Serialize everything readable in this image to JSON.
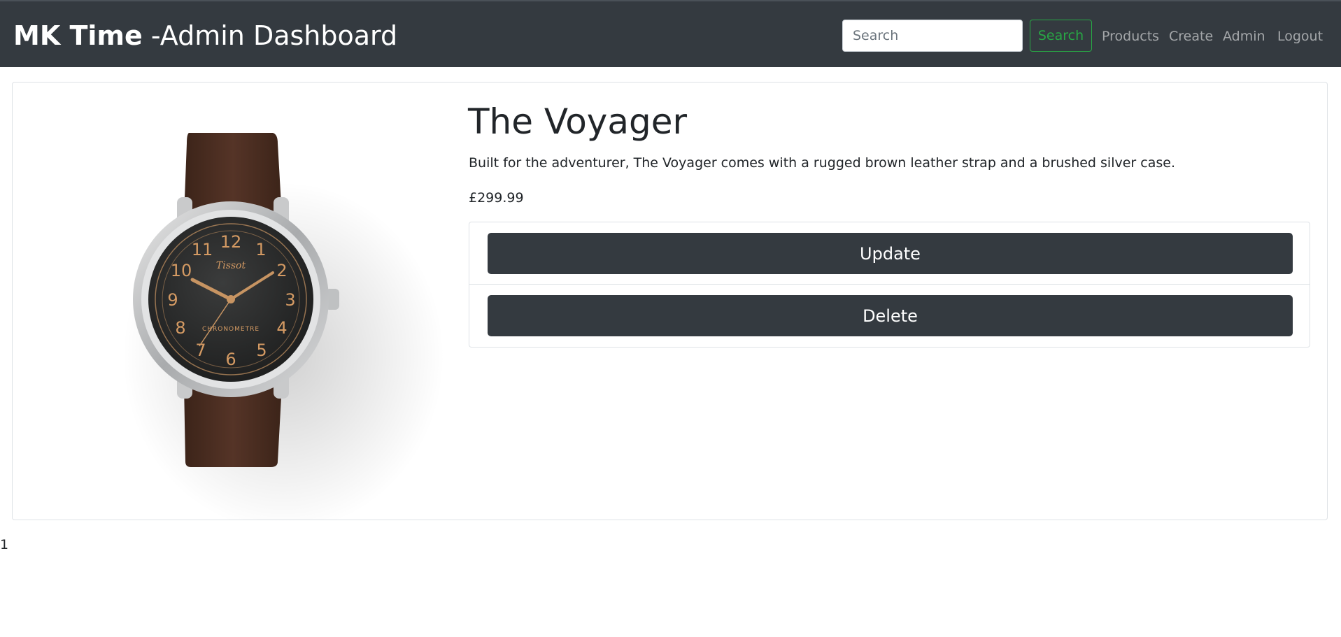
{
  "navbar": {
    "brand_strong": "MK Time",
    "brand_rest": " -Admin Dashboard",
    "search_placeholder": "Search",
    "search_button": "Search",
    "links": [
      "Products",
      "Create",
      "Admin",
      "Logout"
    ]
  },
  "product": {
    "image_icon": "watch-image",
    "title": "The Voyager",
    "description": "Built for the adventurer, The Voyager comes with a rugged brown leather strap and a brushed silver case.",
    "price": "£299.99",
    "update_label": "Update",
    "delete_label": "Delete"
  },
  "footer": {
    "text": "1"
  },
  "colors": {
    "navbar_bg": "#343a40",
    "search_accent": "#28a745",
    "button_bg": "#343a40",
    "strap_brown": "#4a2e23",
    "dial_dark": "#2b2c2c",
    "numeral_orange": "#d49a63"
  }
}
